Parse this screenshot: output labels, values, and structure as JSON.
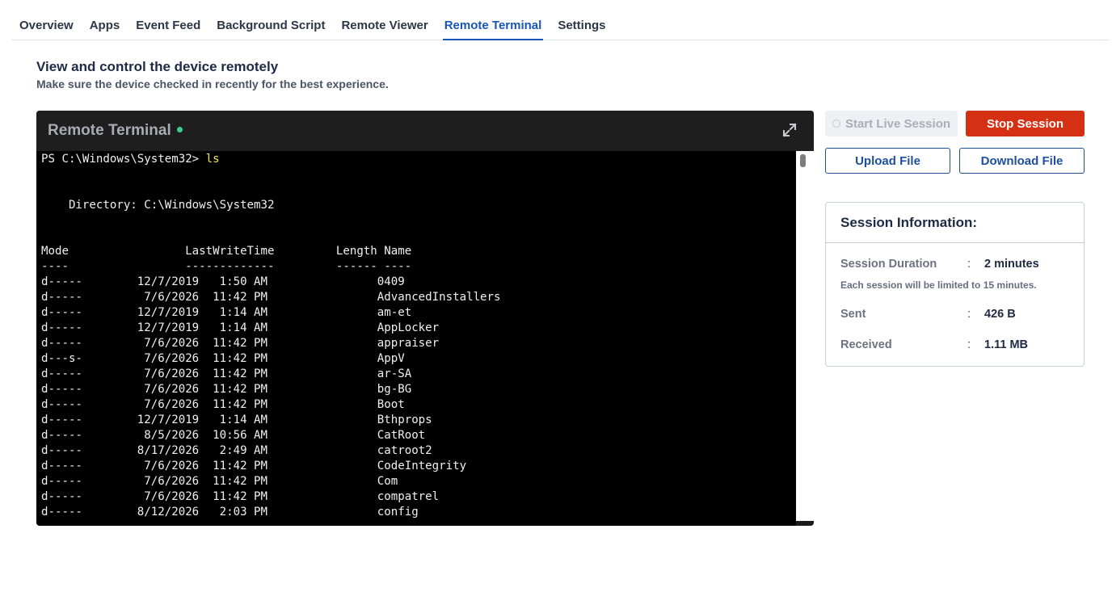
{
  "tabs": [
    {
      "label": "Overview",
      "active": false
    },
    {
      "label": "Apps",
      "active": false
    },
    {
      "label": "Event Feed",
      "active": false
    },
    {
      "label": "Background Script",
      "active": false
    },
    {
      "label": "Remote Viewer",
      "active": false
    },
    {
      "label": "Remote Terminal",
      "active": true
    },
    {
      "label": "Settings",
      "active": false
    }
  ],
  "page": {
    "heading": "View and control the device remotely",
    "subheading": "Make sure the device checked in recently for the best experience."
  },
  "terminal": {
    "title": "Remote Terminal",
    "status_color": "#3ecf8e",
    "expand_icon": "expand-icon",
    "prompt": "PS C:\\Windows\\System32> ",
    "command": "ls",
    "directory_line": "    Directory: C:\\Windows\\System32",
    "header_line": "Mode                 LastWriteTime         Length Name",
    "underline_line": "----                 -------------         ------ ----",
    "rows": [
      "d-----        12/7/2019   1:50 AM                0409",
      "d-----         7/6/2026  11:42 PM                AdvancedInstallers",
      "d-----        12/7/2019   1:14 AM                am-et",
      "d-----        12/7/2019   1:14 AM                AppLocker",
      "d-----         7/6/2026  11:42 PM                appraiser",
      "d---s-         7/6/2026  11:42 PM                AppV",
      "d-----         7/6/2026  11:42 PM                ar-SA",
      "d-----         7/6/2026  11:42 PM                bg-BG",
      "d-----         7/6/2026  11:42 PM                Boot",
      "d-----        12/7/2019   1:14 AM                Bthprops",
      "d-----         8/5/2026  10:56 AM                CatRoot",
      "d-----        8/17/2026   2:49 AM                catroot2",
      "d-----         7/6/2026  11:42 PM                CodeIntegrity",
      "d-----         7/6/2026  11:42 PM                Com",
      "d-----         7/6/2026  11:42 PM                compatrel",
      "d-----        8/12/2026   2:03 PM                config"
    ]
  },
  "actions": {
    "start_label": "Start Live Session",
    "stop_label": "Stop Session",
    "upload_label": "Upload File",
    "download_label": "Download File"
  },
  "session": {
    "title": "Session Information:",
    "duration_label": "Session Duration",
    "duration_value": "2 minutes",
    "note": "Each session will be limited to 15 minutes.",
    "sent_label": "Sent",
    "sent_value": "426 B",
    "received_label": "Received",
    "received_value": "1.11 MB",
    "separator": ":"
  },
  "colors": {
    "accent": "#1856b8",
    "stop_button": "#d63014",
    "command_text": "#f2e15a"
  }
}
